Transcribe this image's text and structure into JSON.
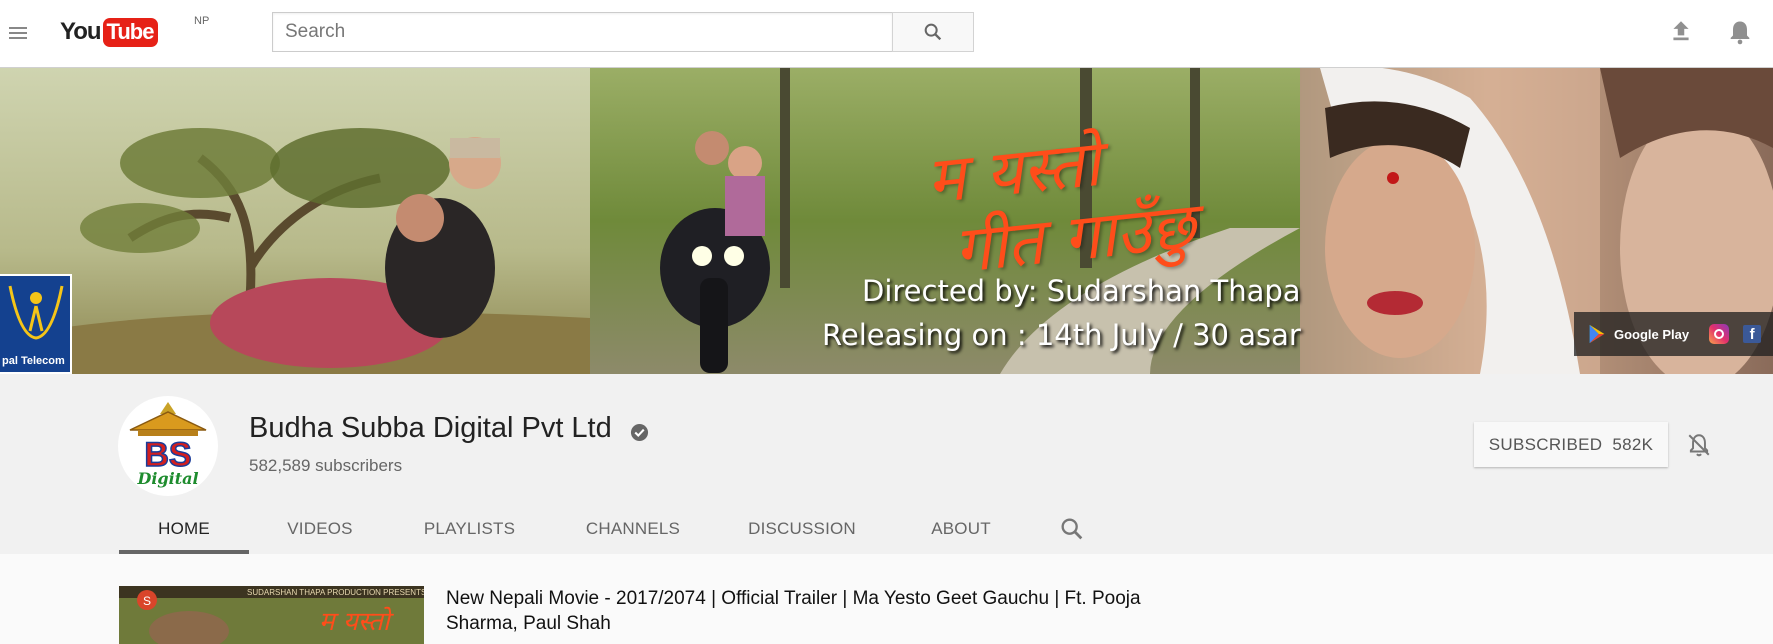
{
  "topbar": {
    "logo_you": "You",
    "logo_tube": "Tube",
    "country": "NP",
    "search_placeholder": "Search"
  },
  "banner": {
    "title_line1": "म यस्तो",
    "title_line2": "गीत गाउँछु",
    "director": "Directed by: Sudarshan Thapa",
    "release": "Releasing on : 14th July / 30 asar",
    "sponsor": "pal Telecom",
    "google_play": "Google Play",
    "facebook_glyph": "f"
  },
  "channel": {
    "name": "Budha Subba Digital Pvt Ltd",
    "subscribers": "582,589 subscribers",
    "subscribe_label": "SUBSCRIBED",
    "subscribe_count": "582K",
    "avatar_text": "BS",
    "avatar_subtext": "Digital"
  },
  "tabs": [
    {
      "label": "HOME",
      "active": true
    },
    {
      "label": "VIDEOS",
      "active": false
    },
    {
      "label": "PLAYLISTS",
      "active": false
    },
    {
      "label": "CHANNELS",
      "active": false
    },
    {
      "label": "DISCUSSION",
      "active": false
    },
    {
      "label": "ABOUT",
      "active": false
    }
  ],
  "featured_video": {
    "title": "New Nepali Movie - 2017/2074 | Official Trailer | Ma Yesto Geet Gauchu | Ft. Pooja Sharma, Paul Shah",
    "thumb_caption": "SUDARSHAN THAPA PRODUCTION PRESENTS"
  },
  "icons": {
    "menu": "hamburger-menu-icon",
    "search": "search-icon",
    "upload": "upload-icon",
    "notifications": "bell-icon",
    "verified": "verified-check-icon",
    "notify_off": "bell-off-icon"
  },
  "colors": {
    "brand_red": "#e62117",
    "banner_title": "#ff4d1a",
    "tab_underline": "#666666"
  }
}
